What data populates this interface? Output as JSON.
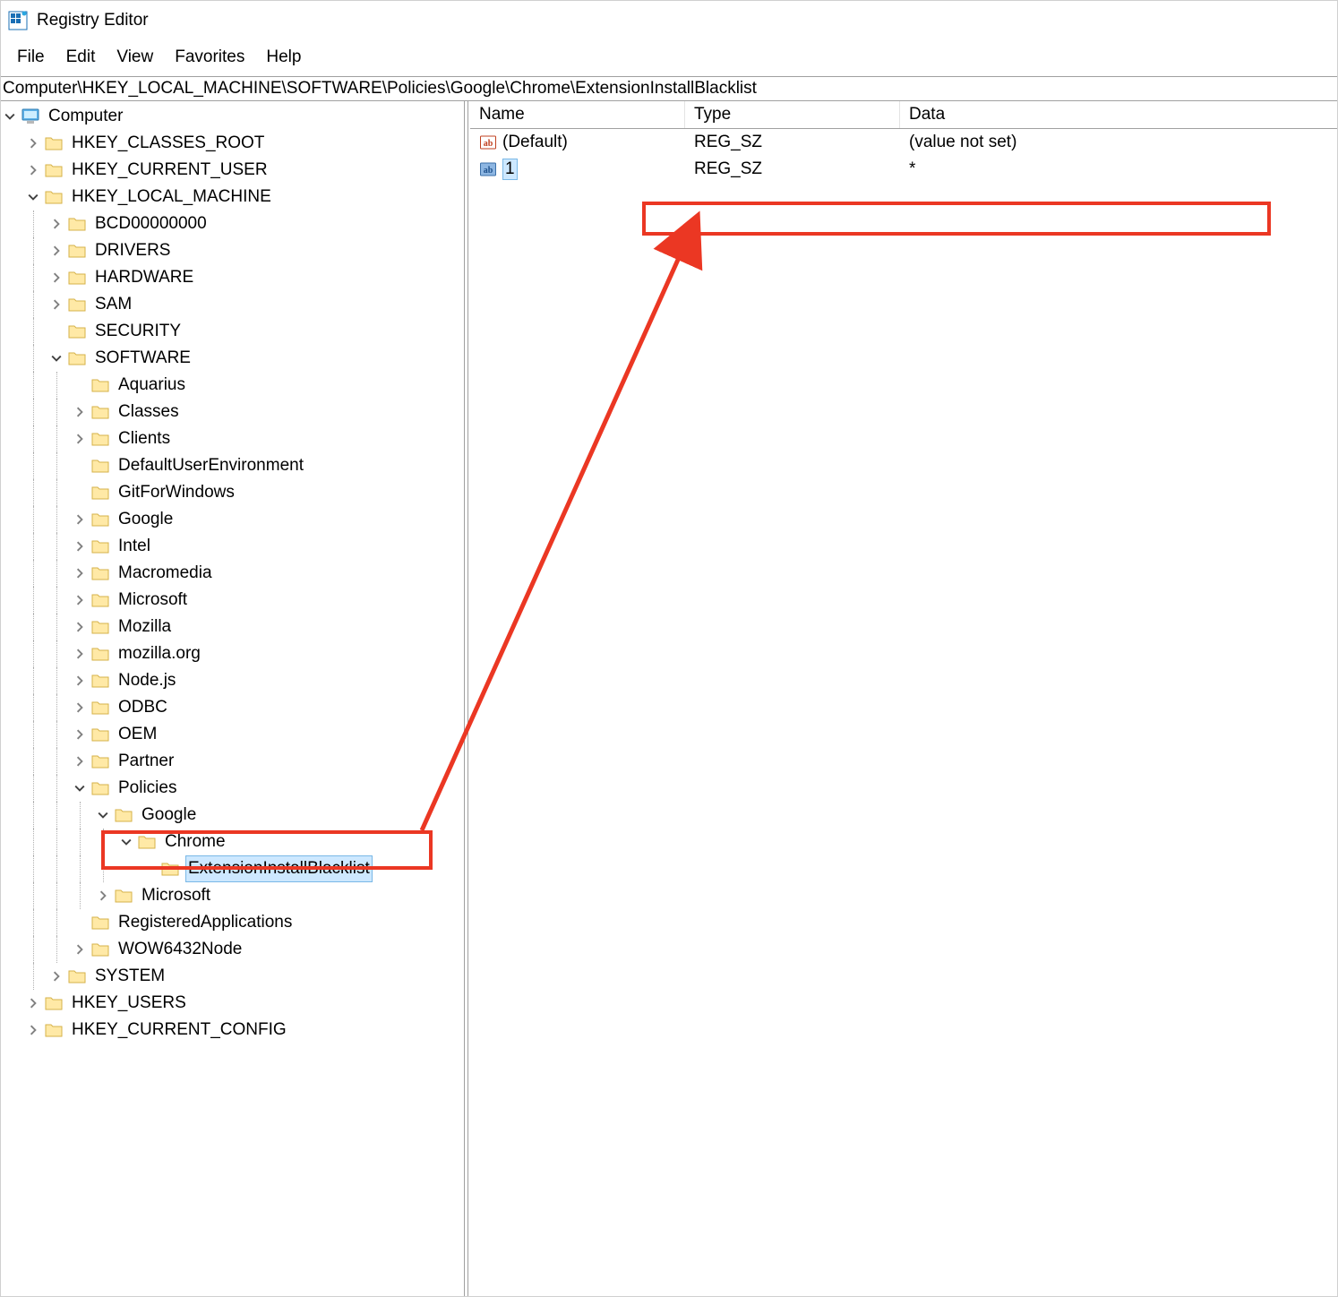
{
  "title": "Registry Editor",
  "menu": [
    "File",
    "Edit",
    "View",
    "Favorites",
    "Help"
  ],
  "address": "Computer\\HKEY_LOCAL_MACHINE\\SOFTWARE\\Policies\\Google\\Chrome\\ExtensionInstallBlacklist",
  "list_headers": {
    "name": "Name",
    "type": "Type",
    "data": "Data"
  },
  "values": [
    {
      "name": "(Default)",
      "type": "REG_SZ",
      "data": "(value not set)",
      "selected": false,
      "icon": "sz"
    },
    {
      "name": "1",
      "type": "REG_SZ",
      "data": "*",
      "selected": true,
      "icon": "sz"
    }
  ],
  "tree": [
    {
      "d": 0,
      "e": "open",
      "i": "computer",
      "t": "Computer"
    },
    {
      "d": 1,
      "e": "closed",
      "i": "folder",
      "t": "HKEY_CLASSES_ROOT"
    },
    {
      "d": 1,
      "e": "closed",
      "i": "folder",
      "t": "HKEY_CURRENT_USER"
    },
    {
      "d": 1,
      "e": "open",
      "i": "folder",
      "t": "HKEY_LOCAL_MACHINE"
    },
    {
      "d": 2,
      "e": "closed",
      "i": "folder",
      "t": "BCD00000000"
    },
    {
      "d": 2,
      "e": "closed",
      "i": "folder",
      "t": "DRIVERS"
    },
    {
      "d": 2,
      "e": "closed",
      "i": "folder",
      "t": "HARDWARE"
    },
    {
      "d": 2,
      "e": "closed",
      "i": "folder",
      "t": "SAM"
    },
    {
      "d": 2,
      "e": "leaf",
      "i": "folder",
      "t": "SECURITY"
    },
    {
      "d": 2,
      "e": "open",
      "i": "folder",
      "t": "SOFTWARE"
    },
    {
      "d": 3,
      "e": "leaf",
      "i": "folder",
      "t": "Aquarius"
    },
    {
      "d": 3,
      "e": "closed",
      "i": "folder",
      "t": "Classes"
    },
    {
      "d": 3,
      "e": "closed",
      "i": "folder",
      "t": "Clients"
    },
    {
      "d": 3,
      "e": "leaf",
      "i": "folder",
      "t": "DefaultUserEnvironment"
    },
    {
      "d": 3,
      "e": "leaf",
      "i": "folder",
      "t": "GitForWindows"
    },
    {
      "d": 3,
      "e": "closed",
      "i": "folder",
      "t": "Google"
    },
    {
      "d": 3,
      "e": "closed",
      "i": "folder",
      "t": "Intel"
    },
    {
      "d": 3,
      "e": "closed",
      "i": "folder",
      "t": "Macromedia"
    },
    {
      "d": 3,
      "e": "closed",
      "i": "folder",
      "t": "Microsoft"
    },
    {
      "d": 3,
      "e": "closed",
      "i": "folder",
      "t": "Mozilla"
    },
    {
      "d": 3,
      "e": "closed",
      "i": "folder",
      "t": "mozilla.org"
    },
    {
      "d": 3,
      "e": "closed",
      "i": "folder",
      "t": "Node.js"
    },
    {
      "d": 3,
      "e": "closed",
      "i": "folder",
      "t": "ODBC"
    },
    {
      "d": 3,
      "e": "closed",
      "i": "folder",
      "t": "OEM"
    },
    {
      "d": 3,
      "e": "closed",
      "i": "folder",
      "t": "Partner"
    },
    {
      "d": 3,
      "e": "open",
      "i": "folder",
      "t": "Policies"
    },
    {
      "d": 4,
      "e": "open",
      "i": "folder",
      "t": "Google"
    },
    {
      "d": 5,
      "e": "open",
      "i": "folder",
      "t": "Chrome"
    },
    {
      "d": 6,
      "e": "leaf",
      "i": "folder",
      "t": "ExtensionInstallBlacklist",
      "sel": true
    },
    {
      "d": 4,
      "e": "closed",
      "i": "folder",
      "t": "Microsoft"
    },
    {
      "d": 3,
      "e": "leaf",
      "i": "folder",
      "t": "RegisteredApplications"
    },
    {
      "d": 3,
      "e": "closed",
      "i": "folder",
      "t": "WOW6432Node"
    },
    {
      "d": 2,
      "e": "closed",
      "i": "folder",
      "t": "SYSTEM"
    },
    {
      "d": 1,
      "e": "closed",
      "i": "folder",
      "t": "HKEY_USERS"
    },
    {
      "d": 1,
      "e": "closed",
      "i": "folder",
      "t": "HKEY_CURRENT_CONFIG"
    }
  ]
}
